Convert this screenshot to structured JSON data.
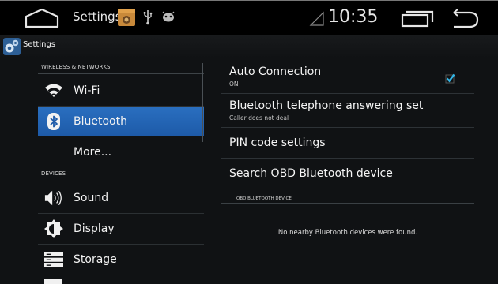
{
  "status_bar": {
    "title": "Settings",
    "clock": "10:35",
    "icons": [
      "home-icon",
      "app-notification-icon",
      "usb-icon",
      "android-notification-icon",
      "signal-icon",
      "recent-apps-icon",
      "back-icon"
    ]
  },
  "action_bar": {
    "title": "Settings",
    "icon": "settings-gear-icon"
  },
  "left_list": {
    "sections": [
      {
        "header": "WIRELESS & NETWORKS",
        "items": [
          {
            "label": "Wi-Fi",
            "icon": "wifi-icon"
          },
          {
            "label": "Bluetooth",
            "icon": "bluetooth-icon",
            "selected": true
          },
          {
            "label": "More...",
            "icon": ""
          }
        ]
      },
      {
        "header": "DEVICES",
        "items": [
          {
            "label": "Sound",
            "icon": "speaker-icon"
          },
          {
            "label": "Display",
            "icon": "brightness-icon"
          },
          {
            "label": "Storage",
            "icon": "storage-icon"
          }
        ]
      }
    ]
  },
  "right_pane": {
    "items": [
      {
        "title": "Auto Connection",
        "summary": "ON",
        "checked": true
      },
      {
        "title": "Bluetooth telephone answering set",
        "summary": "Caller does not deal"
      },
      {
        "title": "PIN code settings"
      },
      {
        "title": "Search OBD Bluetooth device"
      }
    ],
    "obd_header": "OBD BLUETOOTH DEVICE",
    "empty_message": "No nearby Bluetooth devices were found."
  },
  "colors": {
    "accent": "#2a6fc0",
    "background": "#101214",
    "checkbox": "#33b5e5"
  }
}
